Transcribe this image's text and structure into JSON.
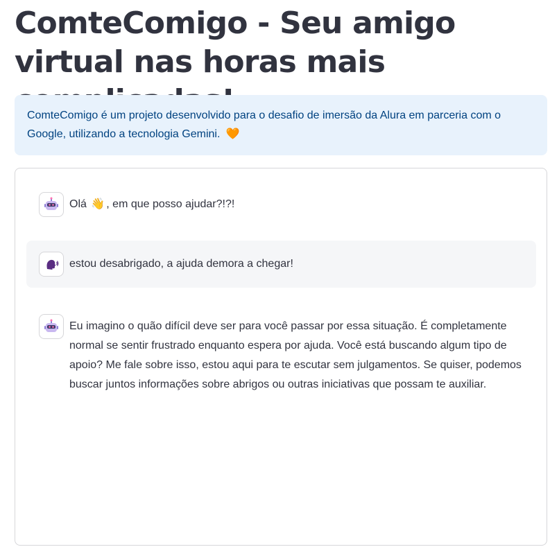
{
  "page": {
    "title": "ComteComigo - Seu amigo virtual nas horas mais complicadas!"
  },
  "info": {
    "text": "ComteComigo é um projeto desenvolvido para o desafio de imersão da Alura em parceria com o Google, utilizando a tecnologia Gemini.",
    "heart_icon": "heart-icon",
    "heart_glyph": "🧡"
  },
  "chat": {
    "messages": [
      {
        "role": "assistant",
        "avatar_icon": "robot-icon",
        "text_before": "Olá",
        "emoji_icon": "waving-hand-icon",
        "emoji_glyph": "👋",
        "text_after": ", em que posso ajudar?!?!"
      },
      {
        "role": "user",
        "avatar_icon": "speaking-head-icon",
        "text": "estou desabrigado, a ajuda demora a chegar!"
      },
      {
        "role": "assistant",
        "avatar_icon": "robot-icon",
        "text": "Eu imagino o quão difícil deve ser para você passar por essa situação. É completamente normal se sentir frustrado enquanto espera por ajuda. Você está buscando algum tipo de apoio? Me fale sobre isso, estou aqui para te escutar sem julgamentos. Se quiser, podemos buscar juntos informações sobre abrigos ou outras iniciativas que possam te auxiliar."
      }
    ]
  }
}
